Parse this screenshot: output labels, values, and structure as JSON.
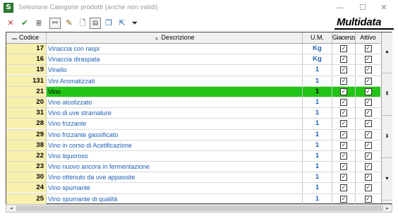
{
  "window": {
    "icon_letter": "S",
    "title": "Selezione Categorie prodotti  (anche non validi)",
    "minimize_glyph": "—",
    "maximize_glyph": "☐",
    "close_glyph": "✕"
  },
  "toolbar": {
    "buttons": [
      {
        "name": "cancel-button",
        "icon": "red-x-icon",
        "glyph": "✕",
        "color": "#c0392b"
      },
      {
        "name": "confirm-button",
        "icon": "green-check-icon",
        "glyph": "✔",
        "color": "#1e8a1e"
      },
      {
        "name": "stack-button",
        "icon": "stack-icon",
        "glyph": "≣",
        "color": "#333333"
      },
      {
        "name": "binoculars-button",
        "icon": "binoculars-icon",
        "glyph": "⚯",
        "color": "#333333"
      },
      {
        "name": "edit-button",
        "icon": "edit-icon",
        "glyph": "✎",
        "color": "#8a5a00"
      },
      {
        "name": "new-doc-button",
        "icon": "document-icon",
        "glyph": "🗋",
        "color": "#333333"
      },
      {
        "name": "edit-doc-button",
        "icon": "document-edit-icon",
        "glyph": "▤",
        "color": "#555555"
      },
      {
        "name": "copy-button",
        "icon": "copy-icon",
        "glyph": "❐",
        "color": "#1f5fb5"
      },
      {
        "name": "export-button",
        "icon": "export-icon",
        "glyph": "⇱",
        "color": "#1f5fb5"
      },
      {
        "name": "filter-button",
        "icon": "filter-icon",
        "glyph": "⏷",
        "color": "#333333"
      }
    ],
    "brand": "Multidata"
  },
  "grid": {
    "columns": {
      "code": "Codice",
      "description": "Descrizione",
      "um": "U.M.",
      "giacenza": "Giacenza",
      "attivo": "Attivo"
    },
    "rows": [
      {
        "code": "17",
        "description": "Vinaccia con raspi",
        "um": "Kg",
        "giacenza": true,
        "attivo": true
      },
      {
        "code": "16",
        "description": "Vinaccia diraspata",
        "um": "Kg",
        "giacenza": true,
        "attivo": true
      },
      {
        "code": "19",
        "description": "Vinello",
        "um": "1",
        "giacenza": true,
        "attivo": true
      },
      {
        "code": "131",
        "description": "Vini Aromatizzati",
        "um": "1",
        "giacenza": true,
        "attivo": true
      },
      {
        "code": "21",
        "description": "Vino",
        "um": "1",
        "giacenza": true,
        "attivo": true,
        "selected": true
      },
      {
        "code": "20",
        "description": "Vino alcolizzato",
        "um": "1",
        "giacenza": true,
        "attivo": true
      },
      {
        "code": "31",
        "description": "Vino di uve stramature",
        "um": "1",
        "giacenza": true,
        "attivo": true
      },
      {
        "code": "28",
        "description": "Vino frizzante",
        "um": "1",
        "giacenza": true,
        "attivo": true
      },
      {
        "code": "29",
        "description": "Vino frizzante gassificato",
        "um": "1",
        "giacenza": true,
        "attivo": true
      },
      {
        "code": "38",
        "description": "Vino in corso di Acetificazione",
        "um": "1",
        "giacenza": true,
        "attivo": true
      },
      {
        "code": "22",
        "description": "Vino liquoroso",
        "um": "1",
        "giacenza": true,
        "attivo": true
      },
      {
        "code": "23",
        "description": "Vino nuovo ancora in fermentazione",
        "um": "1",
        "giacenza": true,
        "attivo": true
      },
      {
        "code": "30",
        "description": "Vino ottenuto da uve appassite",
        "um": "1",
        "giacenza": true,
        "attivo": true
      },
      {
        "code": "24",
        "description": "Vino spumante",
        "um": "1",
        "giacenza": true,
        "attivo": true
      },
      {
        "code": "25",
        "description": "Vino spumante di qualità",
        "um": "1",
        "giacenza": true,
        "attivo": true
      }
    ],
    "check_glyph": "✓",
    "nav": {
      "top_glyph": "▴",
      "page_up_glyph": "⇞",
      "page_down_glyph": "⇟",
      "bottom_glyph": "▾"
    }
  },
  "hscroll": {
    "left_glyph": "◂",
    "right_glyph": "▸"
  },
  "colors": {
    "selected_row": "#22c416",
    "code_column": "#f8f0ad",
    "link_text": "#1f5fb5"
  }
}
